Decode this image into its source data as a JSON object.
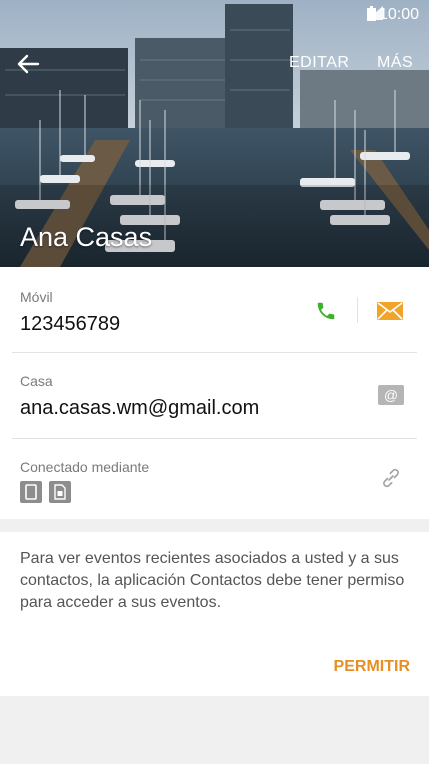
{
  "status_bar": {
    "time": "10:00"
  },
  "app_bar": {
    "edit_label": "EDITAR",
    "more_label": "MÁS"
  },
  "contact": {
    "name": "Ana Casas"
  },
  "details": {
    "mobile": {
      "label": "Móvil",
      "value": "123456789"
    },
    "email": {
      "label": "Casa",
      "value": "ana.casas.wm@gmail.com"
    },
    "linked": {
      "label": "Conectado mediante"
    }
  },
  "permission_card": {
    "message": "Para ver eventos recientes asociados a usted y a sus contactos, la aplicación Contactos debe tener permiso para acceder a sus eventos.",
    "button": "PERMITIR"
  },
  "colors": {
    "accent": "#e58f25",
    "call_green": "#3fb02c",
    "email_orange": "#f0a52a"
  }
}
